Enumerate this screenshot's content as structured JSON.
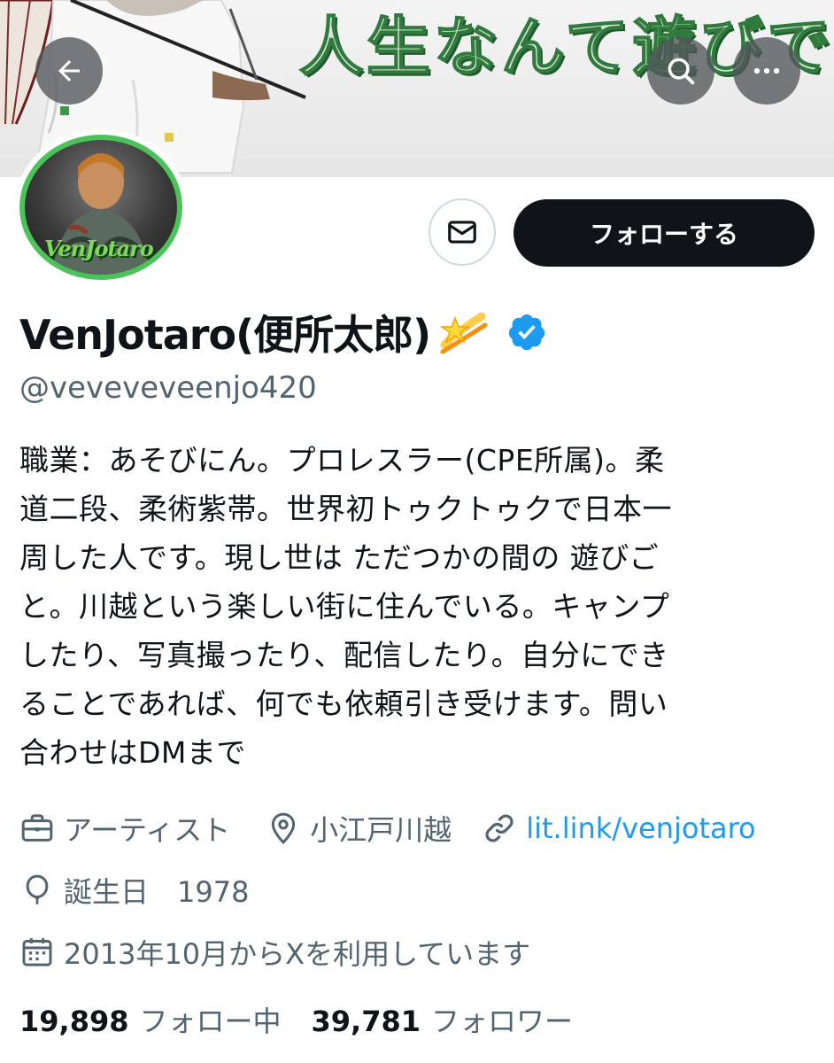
{
  "banner": {
    "slogan": "人生なんて遊びです。"
  },
  "nav": {
    "back_icon": "arrow-left-icon",
    "search_icon": "search-icon",
    "more_icon": "more-horizontal-icon"
  },
  "avatar": {
    "logo_text": "VenJotaro"
  },
  "actions": {
    "dm_icon": "mail-icon",
    "follow_label": "フォローする"
  },
  "profile": {
    "display_name": "VenJotaro(便所太郎)",
    "name_emoji": "dizzy-star-emoji",
    "verified": true,
    "handle": "@veveveveenjo420"
  },
  "bio": {
    "lines": [
      "職業：あそびにん。プロレスラー(CPE所属)。柔",
      "道二段、柔術紫帯。世界初トゥクトゥクで日本一",
      "周した人です。現し世は ただつかの間の 遊びご",
      "と。川越という楽しい街に住んでいる。キャンプ",
      "したり、写真撮ったり、配信したり。自分にでき",
      "ることであれば、何でも依頼引き受けます。問い",
      "合わせはDMまで"
    ]
  },
  "meta": {
    "category": "アーティスト",
    "location": "小江戸川越",
    "link": "lit.link/venjotaro",
    "birthday": "誕生日　1978",
    "joined": "2013年10月からXを利用しています"
  },
  "stats": {
    "following_count": "19,898",
    "following_label": "フォロー中",
    "followers_count": "39,781",
    "followers_label": "フォロワー"
  },
  "colors": {
    "link": "#1d9bf0",
    "verified": "#1d9bf0",
    "follow_button": "#0f1419",
    "secondary_text": "#536471"
  }
}
